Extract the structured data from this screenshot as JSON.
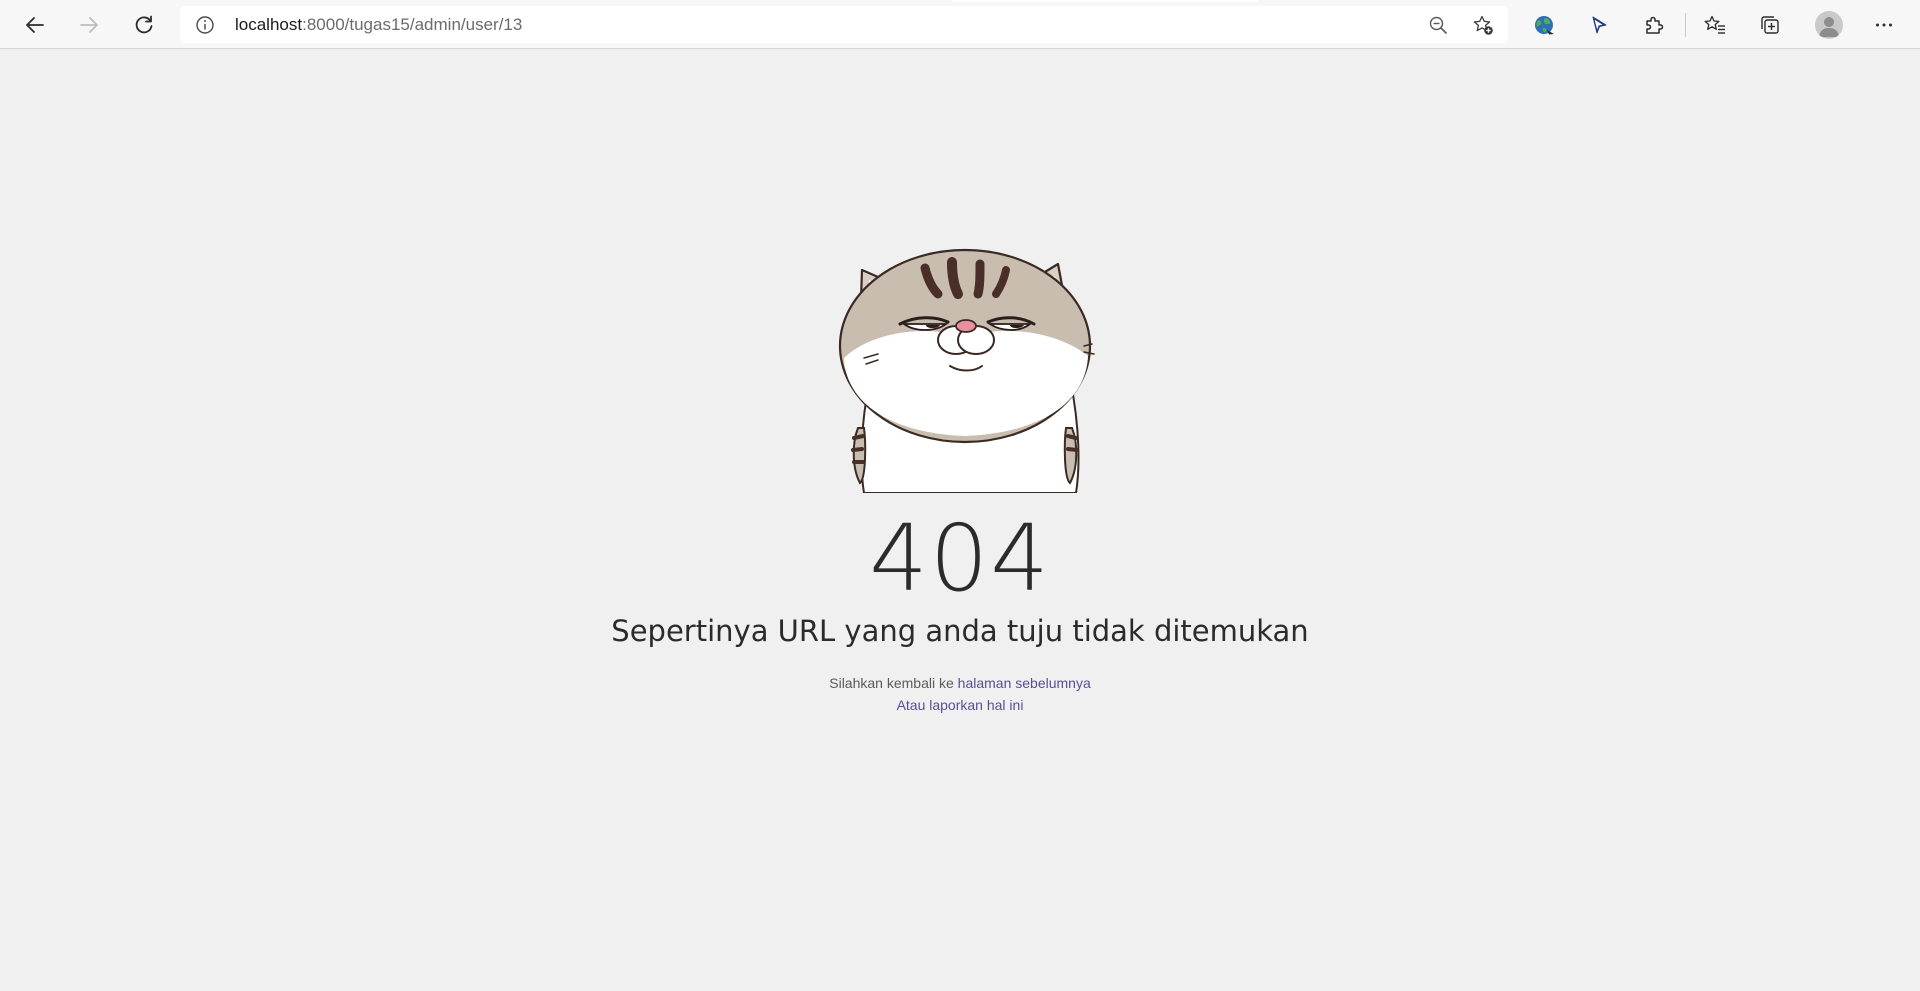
{
  "browser": {
    "url_host": "localhost",
    "url_rest": ":8000/tugas15/admin/user/13",
    "icons": {
      "back": "arrow-left-icon",
      "forward": "arrow-right-icon",
      "refresh": "refresh-icon",
      "site_info": "info-icon",
      "zoom": "zoom-out-icon",
      "add_favorite": "star-add-icon",
      "extension_globe": "globe-icon",
      "extension_cursor": "cursor-icon",
      "extensions": "puzzle-icon",
      "favorites": "favorites-icon",
      "collections": "collections-icon",
      "profile": "avatar",
      "menu": "more-icon"
    }
  },
  "error_page": {
    "code": "404",
    "title": "Sepertinya URL yang anda tuju tidak ditemukan",
    "back_prefix": "Silahkan kembali ke ",
    "back_link": "halaman sebelumnya",
    "report_link": "Atau laporkan hal ini",
    "illustration": "cat-illustration"
  },
  "colors": {
    "page_background": "#f0f0f0",
    "link": "#5b4e96",
    "text": "#2b2b2b"
  }
}
